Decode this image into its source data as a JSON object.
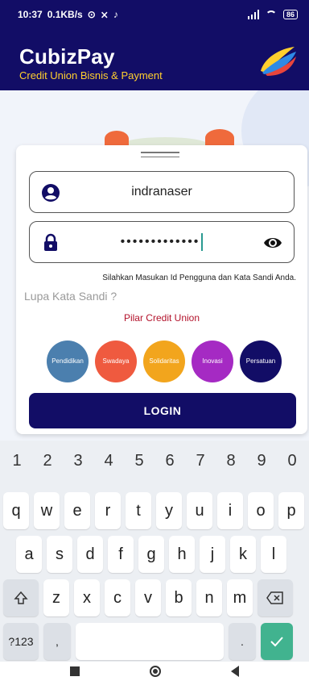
{
  "status_bar": {
    "time": "10:37",
    "speed": "0.1KB/s",
    "battery": "86"
  },
  "app": {
    "title": "CubizPay",
    "subtitle": "Credit Union Bisnis & Payment"
  },
  "form": {
    "username_value": "indranaser",
    "password_value": "•••••••••••••",
    "hint": "Silahkan Masukan Id Pengguna dan Kata Sandi Anda.",
    "forgot_password": "Lupa Kata Sandi ?",
    "pilar_title": "Pilar Credit Union",
    "pilars": [
      {
        "label": "Pendidikan",
        "color": "#4b7fae"
      },
      {
        "label": "Swadaya",
        "color": "#ef5a3f"
      },
      {
        "label": "Solidaritas",
        "color": "#f2a51d"
      },
      {
        "label": "Inovasi",
        "color": "#a52ac3"
      },
      {
        "label": "Persatuan",
        "color": "#120d66"
      }
    ],
    "login_label": "LOGIN"
  },
  "keyboard": {
    "numbers": [
      "1",
      "2",
      "3",
      "4",
      "5",
      "6",
      "7",
      "8",
      "9",
      "0"
    ],
    "row1": [
      "q",
      "w",
      "e",
      "r",
      "t",
      "y",
      "u",
      "i",
      "o",
      "p"
    ],
    "row2": [
      "a",
      "s",
      "d",
      "f",
      "g",
      "h",
      "j",
      "k",
      "l"
    ],
    "row3": [
      "z",
      "x",
      "c",
      "v",
      "b",
      "n",
      "m"
    ],
    "symbols_key": "?123",
    "comma_key": ",",
    "period_key": "."
  },
  "colors": {
    "primary": "#120d66",
    "accent": "#ffcf2e",
    "pilar_title": "#b3122b"
  }
}
